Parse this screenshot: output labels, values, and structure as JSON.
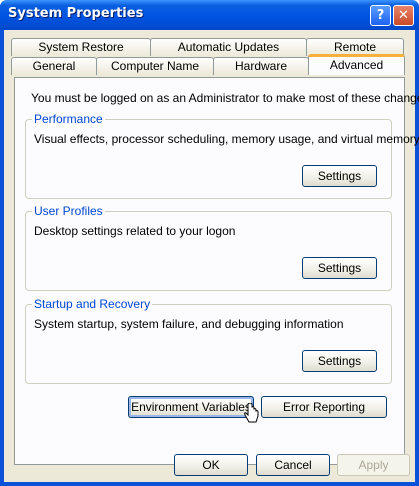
{
  "window": {
    "title": "System Properties",
    "help_label": "?",
    "close_label": "✕"
  },
  "tabs": {
    "row_back": [
      "System Restore",
      "Automatic Updates",
      "Remote"
    ],
    "row_front": [
      "General",
      "Computer Name",
      "Hardware",
      "Advanced"
    ],
    "active": "Advanced"
  },
  "advanced": {
    "notice": "You must be logged on as an Administrator to make most of these changes.",
    "performance": {
      "label": "Performance",
      "desc": "Visual effects, processor scheduling, memory usage, and virtual memory",
      "button": "Settings"
    },
    "user_profiles": {
      "label": "User Profiles",
      "desc": "Desktop settings related to your logon",
      "button": "Settings"
    },
    "startup_recovery": {
      "label": "Startup and Recovery",
      "desc": "System startup, system failure, and debugging information",
      "button": "Settings"
    },
    "env_vars_button": "Environment Variables",
    "error_reporting_button": "Error Reporting"
  },
  "footer": {
    "ok": "OK",
    "cancel": "Cancel",
    "apply": "Apply"
  },
  "colors": {
    "title_bar": "#0054e3",
    "group_label": "#0046d5",
    "active_tab_accent": "#f8b13c"
  }
}
